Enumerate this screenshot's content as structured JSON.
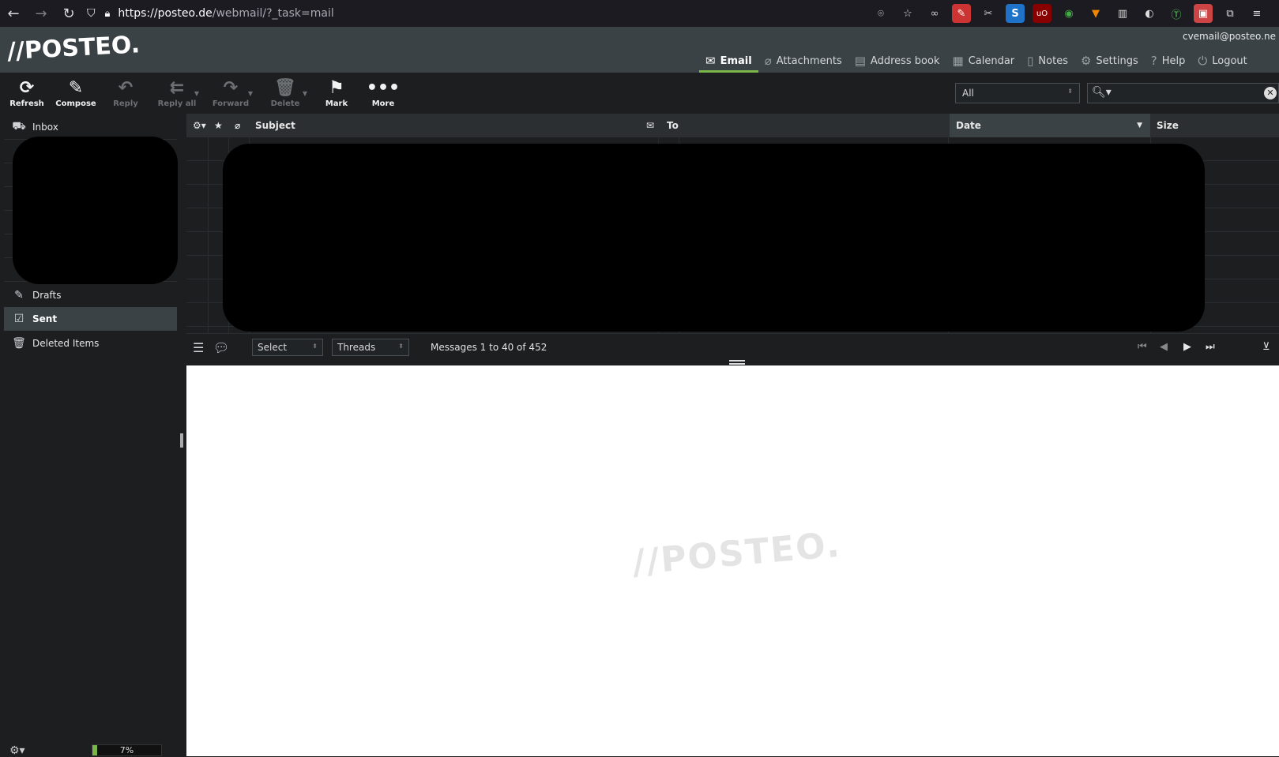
{
  "browser": {
    "url_host": "https://posteo.de",
    "url_path": "/webmail/?_task=mail",
    "back_icon": "back-arrow-icon",
    "forward_icon": "forward-arrow-icon",
    "reload_icon": "reload-icon"
  },
  "app": {
    "logo": "//POSTEO.",
    "username": "cvemail@posteo.ne",
    "nav": [
      {
        "label": "Email",
        "icon": "envelope-icon",
        "active": true
      },
      {
        "label": "Attachments",
        "icon": "paperclip-icon"
      },
      {
        "label": "Address book",
        "icon": "book-icon"
      },
      {
        "label": "Calendar",
        "icon": "calendar-icon"
      },
      {
        "label": "Notes",
        "icon": "note-icon"
      },
      {
        "label": "Settings",
        "icon": "gears-icon"
      },
      {
        "label": "Help",
        "icon": "help-icon"
      },
      {
        "label": "Logout",
        "icon": "power-icon"
      }
    ]
  },
  "toolbar": {
    "refresh": "Refresh",
    "compose": "Compose",
    "reply": "Reply",
    "reply_all": "Reply all",
    "forward": "Forward",
    "delete": "Delete",
    "mark": "Mark",
    "more": "More"
  },
  "filter": {
    "selected": "All"
  },
  "folders": {
    "inbox": "Inbox",
    "drafts": "Drafts",
    "sent": "Sent",
    "deleted": "Deleted Items"
  },
  "quota": {
    "label": "7%",
    "fraction": 0.07
  },
  "list": {
    "col_subject": "Subject",
    "col_to": "To",
    "col_date": "Date",
    "col_size": "Size"
  },
  "footer": {
    "select": "Select",
    "threads": "Threads",
    "count": "Messages 1 to 40 of 452"
  },
  "preview": {
    "watermark": "//POSTEO."
  }
}
